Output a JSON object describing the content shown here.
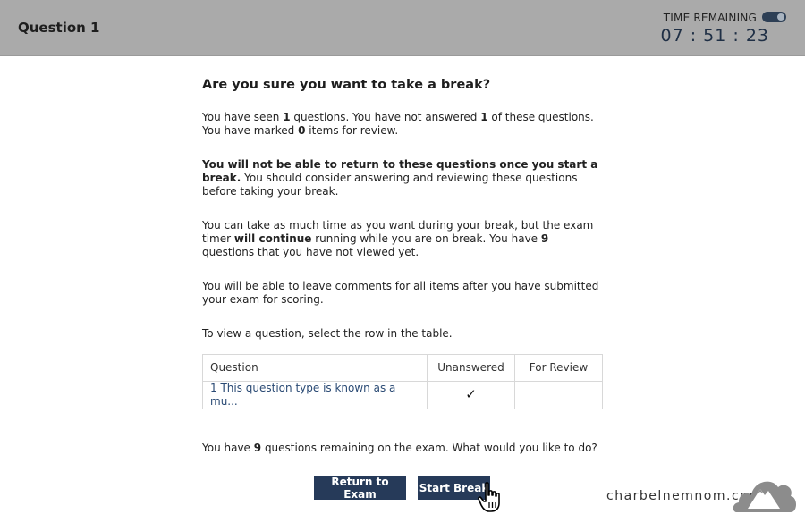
{
  "header": {
    "question_title": "Question 1",
    "time_remaining_label": "TIME REMAINING",
    "timer": "07 : 51 : 23"
  },
  "dialog": {
    "title": "Are you sure you want to take a break?",
    "p1": {
      "a": "You have seen ",
      "seen": "1",
      "b": " questions. You have not answered ",
      "unanswered": "1",
      "c": " of these questions. You have marked ",
      "marked": "0",
      "d": " items for review."
    },
    "p2": {
      "bold": "You will not be able to return to these questions once you start a break.",
      "rest": " You should consider answering and reviewing these questions before taking your break."
    },
    "p3": {
      "a": "You can take as much time as you want during your break, but the exam timer ",
      "bold": "will continue",
      "b": " running while you are on break. You have ",
      "unviewed": "9",
      "c": " questions that you have not viewed yet."
    },
    "p4": "You will be able to leave comments for all items after you have submitted your exam for scoring.",
    "p5": "To view a question, select the row in the table.",
    "table": {
      "headers": [
        "Question",
        "Unanswered",
        "For Review"
      ],
      "rows": [
        {
          "question": "1 This question type is known as a mu...",
          "unanswered": "✓",
          "review": ""
        }
      ]
    },
    "remaining": {
      "a": "You have ",
      "count": "9",
      "b": " questions remaining on the exam. What would you like to do?"
    },
    "buttons": {
      "return": "Return to Exam",
      "start": "Start Break"
    }
  },
  "watermark": {
    "text": "charbelnemnom.com"
  },
  "colors": {
    "header_bg": "#aaaaaa",
    "button_bg": "#263a59",
    "link": "#2a4a74",
    "timer": "#1f2f45"
  }
}
